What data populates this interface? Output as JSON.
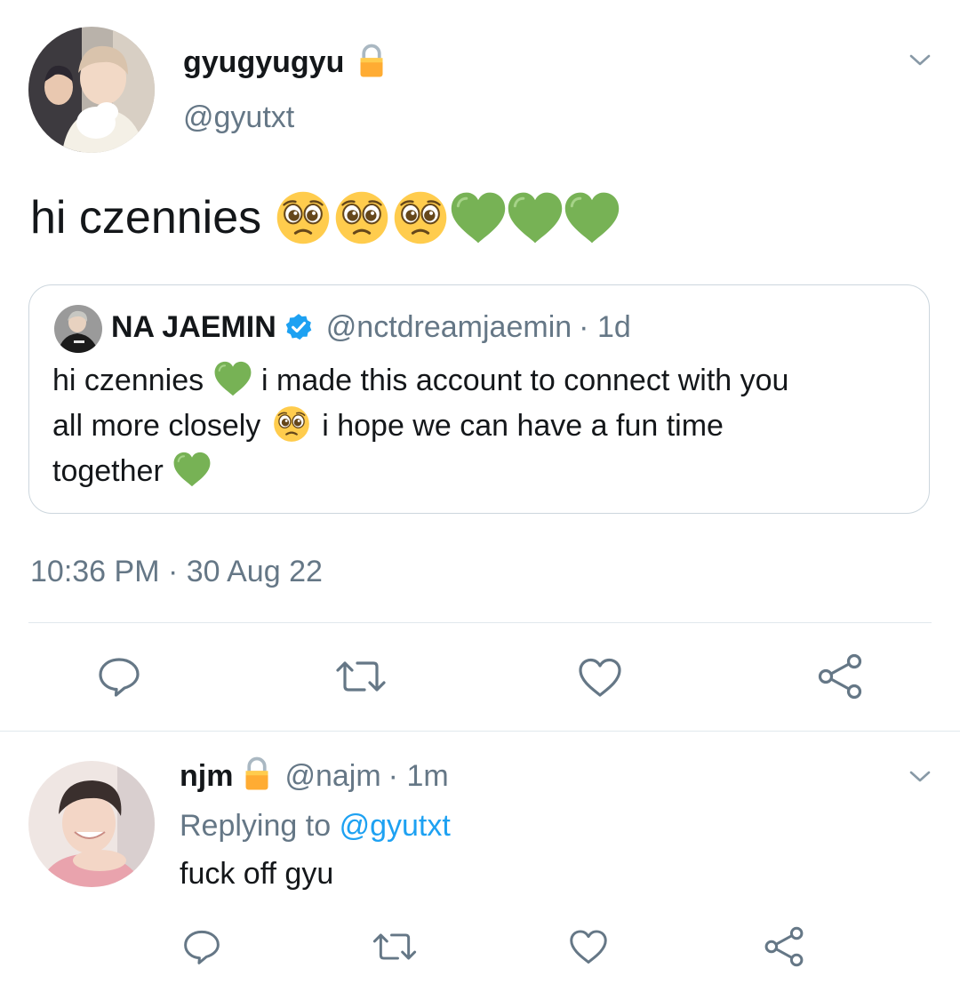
{
  "main_tweet": {
    "display_name": "gyugyugyu",
    "handle": "@gyutxt",
    "text": "hi czennies",
    "emoji_names": [
      "pleading-face",
      "pleading-face",
      "pleading-face",
      "green-heart",
      "green-heart",
      "green-heart"
    ],
    "timestamp": "10:36 PM · 30 Aug 22",
    "quoted": {
      "display_name": "NA JAEMIN",
      "handle": "@nctdreamjaemin",
      "age": "· 1d",
      "line1_a": "hi czennies",
      "line1_b": "i made this account to connect with you",
      "line2_a": "all more closely",
      "line2_b": "i hope we can have a fun time",
      "line3": "together"
    }
  },
  "reply_tweet": {
    "display_name": "njm",
    "handle": "@najm",
    "age": "· 1m",
    "replying_prefix": "Replying to",
    "replying_handle": "@gyutxt",
    "text": "fuck off gyu"
  },
  "actions": [
    "reply-icon",
    "retweet-icon",
    "like-icon",
    "share-icon"
  ],
  "colors": {
    "muted": "#657786",
    "link": "#1da1f2",
    "verified": "#1da1f2",
    "heart_emoji": "#77b255",
    "divider": "#e1e8ed"
  }
}
